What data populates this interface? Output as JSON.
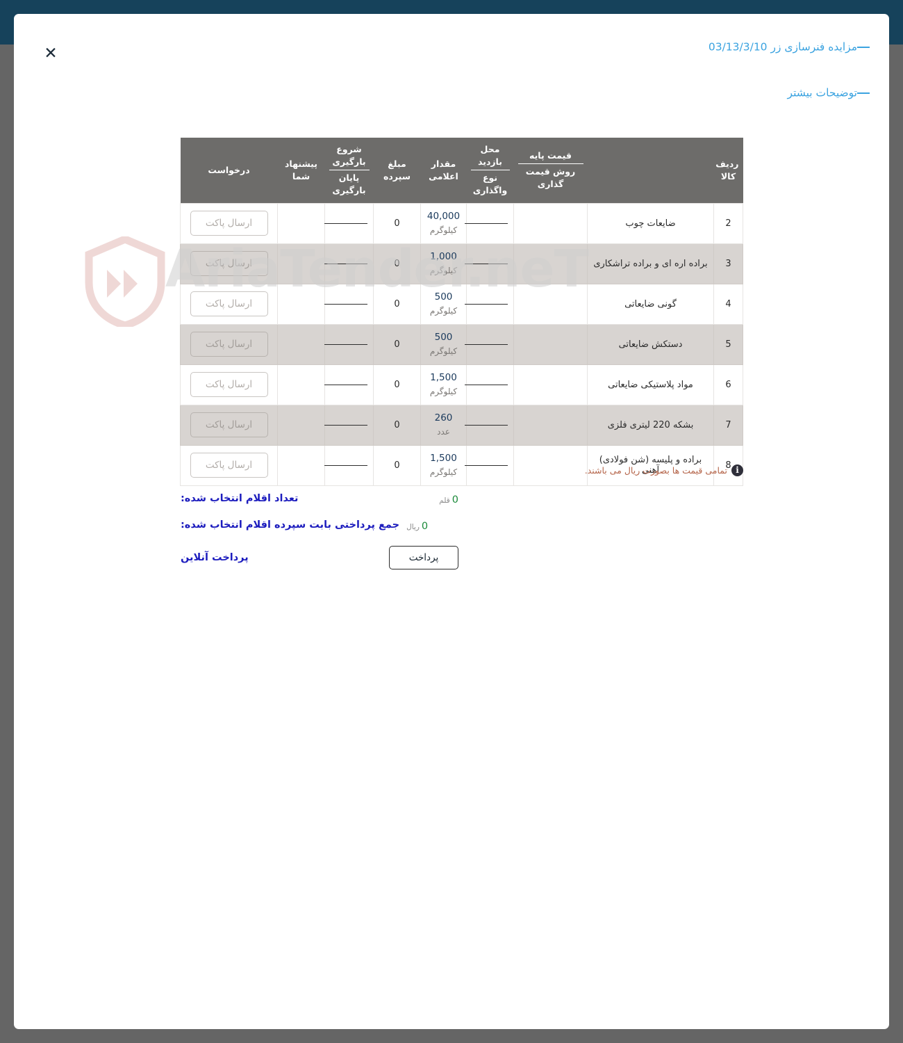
{
  "window": {
    "backdrop_color": "#656565",
    "topbar_color": "#16425b",
    "accent_link_color": "#3ba3e0"
  },
  "header": {
    "close_icon": "close-icon",
    "close_label": "✕",
    "title": "مزایده فنرسازی زر 03/13/3/10",
    "more_details": "توضیحات بیشتر"
  },
  "watermark": {
    "text": "AriaTender.neT"
  },
  "table": {
    "headers": {
      "request": "درخواست",
      "your_offer": "پیشنهاد شما",
      "loading_start": "شروع بارگیری",
      "loading_end": "پایان بارگیری",
      "deposit_amount": "مبلغ سپرده",
      "declared_qty": "مقدار اعلامی",
      "visit_place": "محل بازدید",
      "transfer_type": "نوع واگذاری",
      "base_price": "قیمت پایه",
      "pricing_method": "روش قیمت گذاری",
      "goods_row": "ردیف کالا"
    },
    "send_packet_label": "ارسال پاکت",
    "rows": [
      {
        "no": "2",
        "name": "ضایعات چوب",
        "base_price": "",
        "visit_place": "—",
        "declared_qty": "40,000",
        "declared_unit": "کیلوگرم",
        "deposit": "0",
        "your_offer": "—",
        "request": "ارسال پاکت"
      },
      {
        "no": "3",
        "name": "براده اره ای و براده تراشکاری",
        "base_price": "",
        "visit_place": "—",
        "declared_qty": "1,000",
        "declared_unit": "کیلوگرم",
        "deposit": "0",
        "your_offer": "—",
        "request": "ارسال پاکت"
      },
      {
        "no": "4",
        "name": "گونی ضایعاتی",
        "base_price": "",
        "visit_place": "—",
        "declared_qty": "500",
        "declared_unit": "کیلوگرم",
        "deposit": "0",
        "your_offer": "—",
        "request": "ارسال پاکت"
      },
      {
        "no": "5",
        "name": "دستکش ضایعاتی",
        "base_price": "",
        "visit_place": "—",
        "declared_qty": "500",
        "declared_unit": "کیلوگرم",
        "deposit": "0",
        "your_offer": "—",
        "request": "ارسال پاکت"
      },
      {
        "no": "6",
        "name": "مواد پلاستیکی ضایعاتی",
        "base_price": "",
        "visit_place": "—",
        "declared_qty": "1,500",
        "declared_unit": "کیلوگرم",
        "deposit": "0",
        "your_offer": "—",
        "request": "ارسال پاکت"
      },
      {
        "no": "7",
        "name": "بشکه 220 لیتری فلزی",
        "base_price": "",
        "visit_place": "—",
        "declared_qty": "260",
        "declared_unit": "عدد",
        "deposit": "0",
        "your_offer": "—",
        "request": "ارسال پاکت"
      },
      {
        "no": "8",
        "name": "براده و پلیسه (شن فولادی) آهنی",
        "base_price": "",
        "visit_place": "—",
        "declared_qty": "1,500",
        "declared_unit": "کیلوگرم",
        "deposit": "0",
        "your_offer": "—",
        "request": "ارسال پاکت"
      }
    ]
  },
  "note": {
    "icon": "info-icon",
    "icon_glyph": "i",
    "text": "تمامی قیمت ها بصورت ریال می باشند.",
    "color": "#b5654a"
  },
  "summary": {
    "selected_count_label": "تعداد اقلام انتخاب شده:",
    "selected_count_value": "0",
    "selected_count_unit": "قلم",
    "deposit_total_label": "جمع پرداختی بابت سپرده اقلام انتخاب شده:",
    "deposit_total_value": "0",
    "deposit_total_unit": "ریال",
    "online_payment_label": "پرداخت آنلاین",
    "pay_button_label": "پرداخت",
    "label_color": "#1d1dbe",
    "value_color": "#1b8a3a"
  }
}
